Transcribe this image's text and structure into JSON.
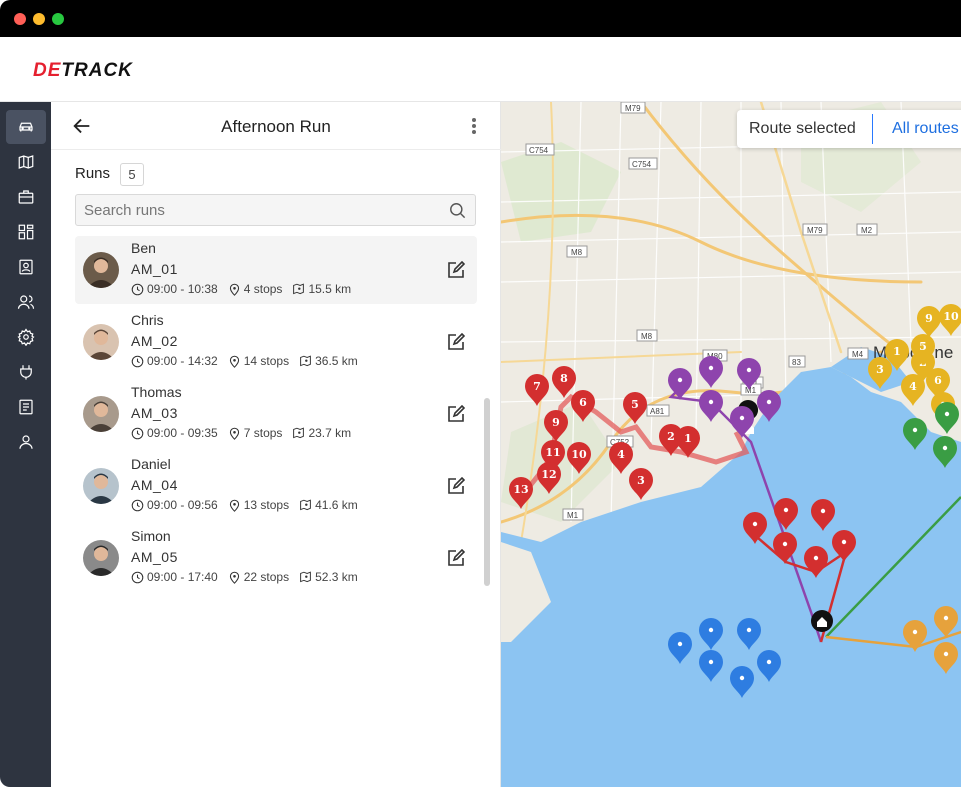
{
  "brand": {
    "logo_accent": "DE",
    "logo_rest": "TRACK",
    "accent_color": "#e5202f"
  },
  "nav": {
    "items": [
      {
        "name": "vehicle-icon",
        "active": true
      },
      {
        "name": "map-icon"
      },
      {
        "name": "briefcase-icon"
      },
      {
        "name": "dashboard-icon"
      },
      {
        "name": "contact-card-icon"
      },
      {
        "name": "users-icon"
      },
      {
        "name": "settings-icon"
      },
      {
        "name": "plug-icon"
      },
      {
        "name": "document-icon"
      },
      {
        "name": "profile-icon"
      }
    ]
  },
  "panel": {
    "title": "Afternoon Run",
    "runs_label": "Runs",
    "runs_count": "5",
    "search_placeholder": "Search runs"
  },
  "runs": [
    {
      "name": "Ben",
      "code": "AM_01",
      "time": "09:00 - 10:38",
      "stops": "4 stops",
      "distance": "15.5 km",
      "selected": true
    },
    {
      "name": "Chris",
      "code": "AM_02",
      "time": "09:00 - 14:32",
      "stops": "14 stops",
      "distance": "36.5 km"
    },
    {
      "name": "Thomas",
      "code": "AM_03",
      "time": "09:00 - 09:35",
      "stops": "7 stops",
      "distance": "23.7 km"
    },
    {
      "name": "Daniel",
      "code": "AM_04",
      "time": "09:00 - 09:56",
      "stops": "13 stops",
      "distance": "41.6 km"
    },
    {
      "name": "Simon",
      "code": "AM_05",
      "time": "09:00 - 17:40",
      "stops": "22 stops",
      "distance": "52.3 km"
    }
  ],
  "map": {
    "toggle_selected": "Route selected",
    "toggle_all": "All routes",
    "city_label": "Melbourne",
    "road_labels": [
      "M79",
      "C754",
      "C754",
      "M79",
      "M2",
      "M8",
      "M8",
      "M80",
      "M1",
      "M4",
      "M1",
      "A81",
      "C752",
      "M1",
      "83"
    ],
    "route_colors": {
      "red": "#d32f2f",
      "purple": "#8e44ad",
      "yellow": "#e6b422",
      "green": "#3a9d44",
      "blue": "#2e7de1",
      "orange": "#e6a23c"
    },
    "red_markers": [
      "1",
      "2",
      "3",
      "4",
      "5",
      "6",
      "7",
      "8",
      "9",
      "10",
      "11",
      "12",
      "13"
    ],
    "yellow_markers": [
      "1",
      "2",
      "3",
      "4",
      "5",
      "6",
      "9",
      "10"
    ]
  }
}
